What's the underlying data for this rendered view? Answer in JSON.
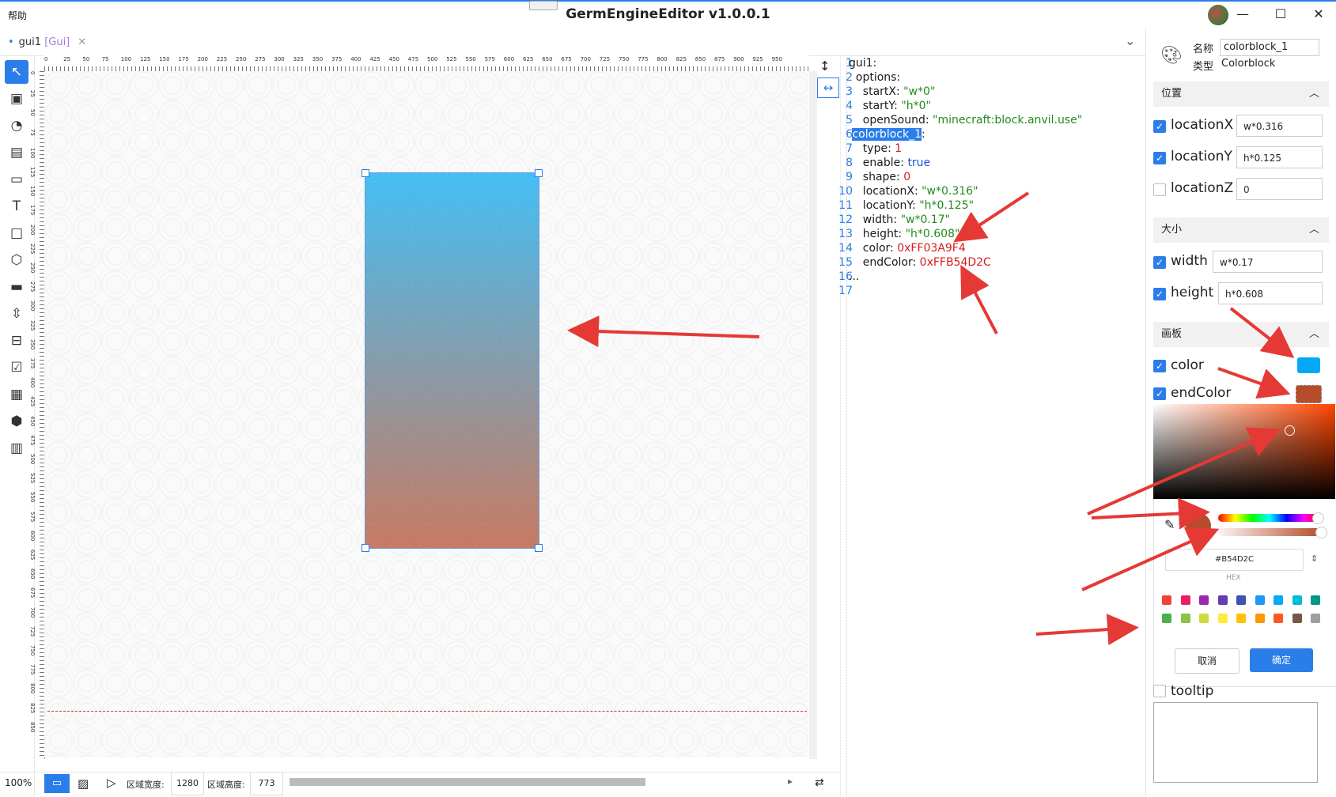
{
  "app": {
    "menu_help": "帮助",
    "title": "GermEngineEditor v1.0.0.1",
    "window_buttons": {
      "minimize": "—",
      "maximize": "☐",
      "close": "✕"
    }
  },
  "tabs": [
    {
      "name": "gui1",
      "tag": "[Gui]"
    }
  ],
  "toolbar": {
    "icons": [
      "select-icon",
      "image-icon",
      "palette-icon",
      "gif-icon",
      "button-icon",
      "text-icon",
      "rect-icon",
      "cube-icon",
      "input-icon",
      "scroll-icon",
      "slot-icon",
      "checkbox-icon",
      "layout-icon",
      "entity-icon",
      "canvas-icon"
    ]
  },
  "ruler": {
    "h_labels": [
      "0",
      "25",
      "50",
      "75",
      "100",
      "125",
      "150",
      "175",
      "200",
      "225",
      "250",
      "275",
      "300",
      "325",
      "350",
      "375",
      "400",
      "425",
      "450",
      "475",
      "500",
      "525",
      "550",
      "575",
      "600",
      "625",
      "650",
      "675",
      "700",
      "725",
      "750",
      "775",
      "800",
      "825",
      "850",
      "875",
      "900",
      "925",
      "950"
    ],
    "v_labels": [
      "0",
      "25",
      "50",
      "75",
      "100",
      "125",
      "150",
      "175",
      "200",
      "225",
      "250",
      "275",
      "300",
      "325",
      "350",
      "375",
      "400",
      "425",
      "450",
      "475",
      "500",
      "525",
      "550",
      "575",
      "600",
      "625",
      "650",
      "675",
      "700",
      "725",
      "750",
      "775",
      "800",
      "825",
      "850"
    ]
  },
  "status": {
    "zoom": "100%",
    "width_label": "区域宽度:",
    "width_value": "1280",
    "height_label": "区域高度:",
    "height_value": "773"
  },
  "code": {
    "line_numbers": [
      "1",
      "2",
      "3",
      "4",
      "5",
      "6",
      "7",
      "8",
      "9",
      "10",
      "11",
      "12",
      "13",
      "14",
      "15",
      "16",
      "17"
    ],
    "l1": "gui1:",
    "l2": "  options:",
    "l3_key": "    startX: ",
    "l3_val": "\"w*0\"",
    "l4_key": "    startY: ",
    "l4_val": "\"h*0\"",
    "l5_key": "    openSound: ",
    "l5_val": "\"minecraft:block.anvil.use\"",
    "l6_name": "colorblock_1",
    "l6_colon": ":",
    "l7_key": "    type: ",
    "l7_val": "1",
    "l8_key": "    enable: ",
    "l8_val": "true",
    "l9_key": "    shape: ",
    "l9_val": "0",
    "l10_key": "    locationX: ",
    "l10_val": "\"w*0.316\"",
    "l11_key": "    locationY: ",
    "l11_val": "\"h*0.125\"",
    "l12_key": "    width: ",
    "l12_val": "\"w*0.17\"",
    "l13_key": "    height: ",
    "l13_val": "\"h*0.608\"",
    "l14_key": "    color: ",
    "l14_val": "0xFF03A9F4",
    "l15_key": "    endColor: ",
    "l15_val": "0xFFB54D2C",
    "l16": "...",
    "l17": ""
  },
  "props": {
    "name_label": "名称",
    "name_value": "colorblock_1",
    "type_label": "类型",
    "type_value": "Colorblock",
    "sections": {
      "position": "位置",
      "size": "大小",
      "canvas": "画板"
    },
    "locationX": {
      "label": "locationX",
      "value": "w*0.316",
      "checked": true
    },
    "locationY": {
      "label": "locationY",
      "value": "h*0.125",
      "checked": true
    },
    "locationZ": {
      "label": "locationZ",
      "value": "0",
      "checked": false
    },
    "width": {
      "label": "width",
      "value": "w*0.17",
      "checked": true
    },
    "height": {
      "label": "height",
      "value": "h*0.608",
      "checked": true
    },
    "color": {
      "label": "color",
      "value": "#03A9F4",
      "checked": true
    },
    "endColor": {
      "label": "endColor",
      "value": "#B54D2C",
      "checked": true
    },
    "tooltip": {
      "label": "tooltip",
      "checked": false
    }
  },
  "picker": {
    "hex_value": "#B54D2C",
    "hex_label": "HEX",
    "hue_level": 0.96,
    "alpha_level": 0.99,
    "swatches_row1": [
      "#f44336",
      "#e91e63",
      "#9c27b0",
      "#673ab7",
      "#3f51b5",
      "#2196f3",
      "#03a9f4",
      "#00bcd4",
      "#009688"
    ],
    "swatches_row2": [
      "#4caf50",
      "#8bc34a",
      "#cddc39",
      "#ffeb3b",
      "#ffc107",
      "#ff9800",
      "#ff5722",
      "#795548",
      "#9e9e9e"
    ],
    "cancel": "取消",
    "ok": "确定"
  },
  "colors": {
    "accent": "#2b7de9",
    "block_start": "#03A9F4",
    "block_end": "#B54D2C",
    "arrow": "#e53935"
  }
}
